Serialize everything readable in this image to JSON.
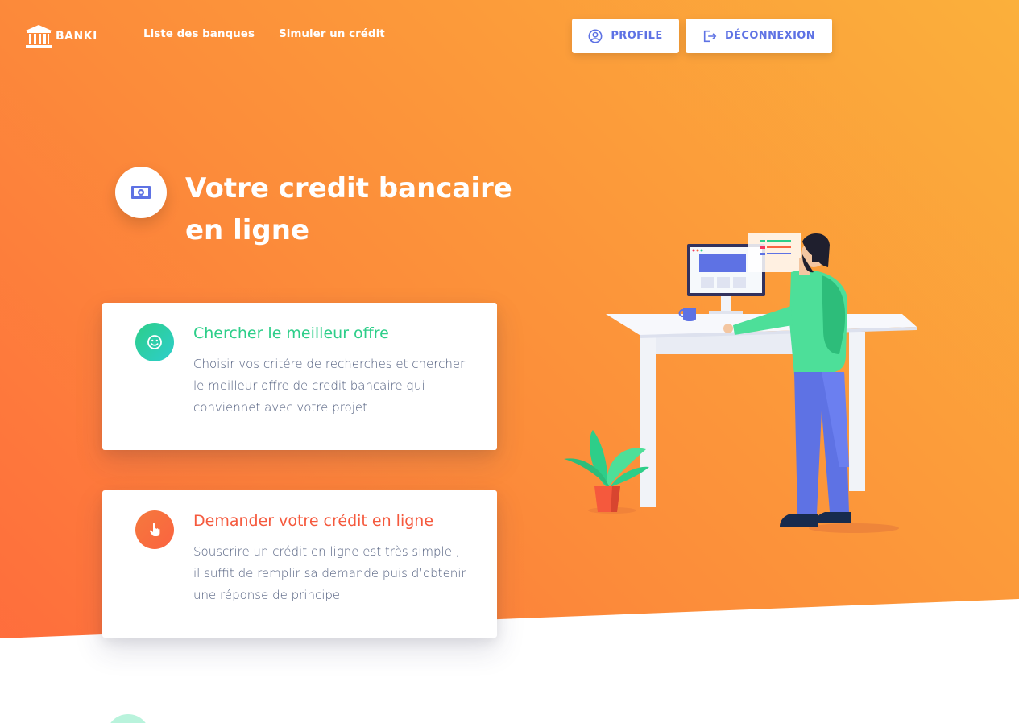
{
  "brand": {
    "name": "BANKI"
  },
  "nav": {
    "links": [
      "Liste des banques",
      "Simuler un crédit"
    ],
    "profile_label": "PROFILE",
    "logout_label": "DÉCONNEXION"
  },
  "hero": {
    "title_line1": "Votre credit bancaire",
    "title_line2": "en ligne"
  },
  "cards": [
    {
      "title": "Chercher le meilleur offre",
      "desc": "Choisir vos critére de recherches et chercher le meilleur offre de credit bancaire qui conviennet avec votre projet",
      "color": "#2dce89",
      "icon": "smile-icon"
    },
    {
      "title": "Demander votre crédit en ligne",
      "desc": "Souscrire un crédit en ligne est très simple , il suffit de remplir sa demande puis d’obtenir une réponse de principe.",
      "color": "#f5593d",
      "icon": "pointer-hand-icon"
    }
  ],
  "colors": {
    "accent": "#5e72e4",
    "hero_start": "#ff6a3d",
    "hero_end": "#fbb03b"
  }
}
